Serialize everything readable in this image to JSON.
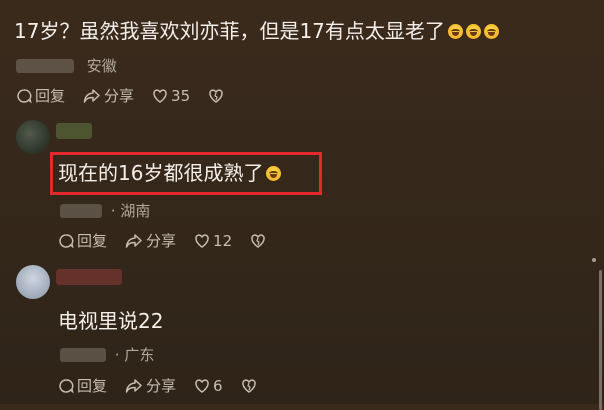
{
  "comments": [
    {
      "text": "17岁？虽然我喜欢刘亦菲，但是17有点太显老了",
      "emoji_icon": "laughing-tears-emoji",
      "location": "安徽",
      "reply_label": "回复",
      "share_label": "分享",
      "like_count": "35"
    },
    {
      "text": "现在的16岁都很成熟了",
      "emoji_icon": "laughing-tears-emoji",
      "location": "· 湖南",
      "reply_label": "回复",
      "share_label": "分享",
      "like_count": "12",
      "highlight_color": "#e5282b"
    },
    {
      "text": "电视里说22",
      "location": "· 广东",
      "reply_label": "回复",
      "share_label": "分享",
      "like_count": "6"
    }
  ],
  "colors": {
    "background": "#35281b",
    "text": "#f4efea",
    "meta": "#b3a89c",
    "highlight": "#e5282b"
  }
}
